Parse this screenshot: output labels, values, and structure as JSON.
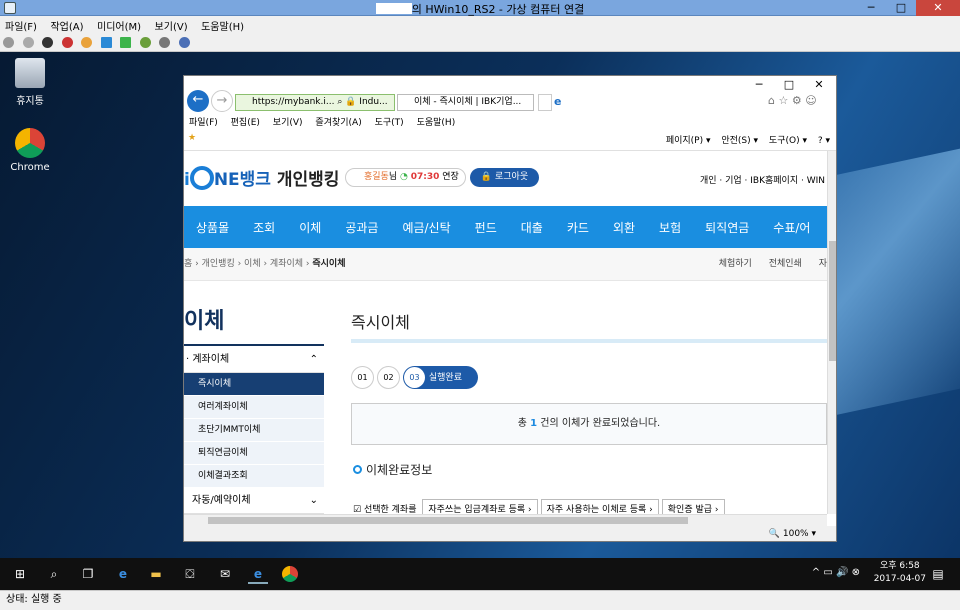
{
  "vm": {
    "title": "의 HWin10_RS2 - 가상 컴퓨터 연결",
    "min": "─",
    "max": "□",
    "close": "✕",
    "menu": [
      "파일(F)",
      "작업(A)",
      "미디어(M)",
      "보기(V)",
      "도움말(H)"
    ],
    "status": "상태: 실행 중"
  },
  "desktop": {
    "icons": [
      {
        "label": "휴지통"
      },
      {
        "label": "Chrome"
      }
    ]
  },
  "ie": {
    "address": "https://mybank.i...",
    "address_more": "Indu...",
    "tab": "이체 - 즉시이체 | IBK기업...",
    "menu": [
      "파일(F)",
      "편집(E)",
      "보기(V)",
      "즐겨찾기(A)",
      "도구(T)",
      "도움말(H)"
    ],
    "cmd": [
      "페이지(P) ▾",
      "안전(S) ▾",
      "도구(O) ▾",
      "? ▾"
    ],
    "zoom": "🔍 100% ▾"
  },
  "page": {
    "brand": "NE뱅크",
    "brand_sub": "개인뱅킹",
    "user_name": "홍길동",
    "user_suffix": "님",
    "timer": "07:30",
    "extend": "연장",
    "logout": "🔒 로그아웃",
    "toplinks": "개인 · 기업 · IBK홈페이지 · WIN",
    "gnb": [
      "상품몰",
      "조회",
      "이체",
      "공과금",
      "예금/신탁",
      "펀드",
      "대출",
      "카드",
      "외환",
      "보험",
      "퇴직연금",
      "수표/어"
    ],
    "crumb": [
      "홈 › 개인뱅킹 › 이체 › 계좌이체 › ",
      "즉시이체"
    ],
    "crumb_right": [
      "체험하기",
      "전체인쇄",
      "자"
    ],
    "lnb_title": "이체",
    "lnb_group": "· 계좌이체",
    "lnb_items": [
      "즉시이체",
      "여러계좌이체",
      "초단기MMT이체",
      "퇴직연금이체",
      "이체결과조회"
    ],
    "lnb_group2": "자동/예약이체",
    "heading": "즉시이체",
    "steps": [
      "01",
      "02",
      "03"
    ],
    "step_label": "실행완료",
    "done_pre": "총 ",
    "done_count": "1",
    "done_post": " 건의 이체가 완료되었습니다.",
    "section": "이체완료정보",
    "check_label": "선택한 계좌를",
    "buttons": [
      "자주쓰는 입금계좌로 등록 ›",
      "자주 사용하는 이체로 등록 ›",
      "확인증 발급 ›"
    ]
  },
  "taskbar": {
    "time": "오후 6:58",
    "date": "2017-04-07"
  }
}
